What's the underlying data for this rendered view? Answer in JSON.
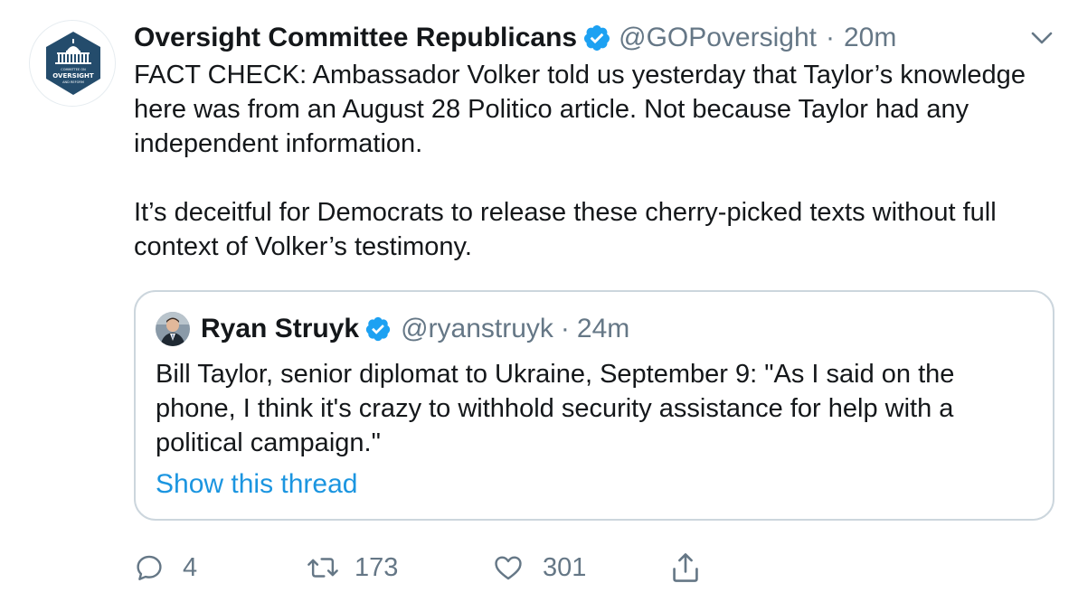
{
  "tweet": {
    "author": {
      "display_name": "Oversight Committee Republicans",
      "handle": "@GOPoversight",
      "time": "20m",
      "avatar_text": "OVERSIGHT"
    },
    "separator": "·",
    "body": [
      "FACT CHECK: Ambassador Volker told us yesterday that Taylor’s knowledge here was from an August 28 Politico article. Not because Taylor had any independent information.",
      "It’s deceitful for Democrats to release these cherry-picked texts without full context of Volker’s testimony."
    ],
    "quoted": {
      "display_name": "Ryan Struyk",
      "handle": "@ryanstruyk",
      "time": "24m",
      "text": "Bill Taylor, senior diplomat to Ukraine, September 9: \"As I said on the phone, I think it's crazy to withhold security assistance for help with a political campaign.\"",
      "show_thread_label": "Show this thread"
    },
    "actions": {
      "reply_count": "4",
      "retweet_count": "173",
      "like_count": "301"
    },
    "icons": {
      "verified": "verified-badge-icon",
      "menu": "chevron-down-icon",
      "reply": "reply-icon",
      "retweet": "retweet-icon",
      "like": "heart-icon",
      "share": "share-icon"
    },
    "colors": {
      "accent": "#1b95e0",
      "verified": "#1da1f2",
      "secondary_text": "#657786",
      "border": "#ccd6dd",
      "avatar_bg": "#244c6c"
    }
  }
}
